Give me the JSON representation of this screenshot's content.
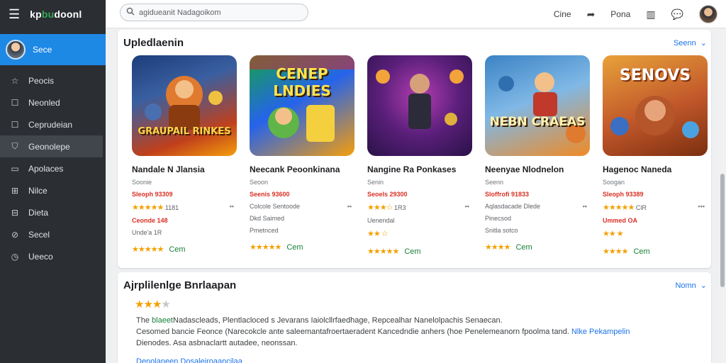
{
  "app": {
    "brand_main": "kp",
    "brand_accent": "bu",
    "brand_rest": "doonl"
  },
  "sidebar": {
    "profile_label": "Sece",
    "items": [
      {
        "label": "Peocis",
        "icon": "star-icon"
      },
      {
        "label": "Neonled",
        "icon": "square-icon"
      },
      {
        "label": "Ceprudeian",
        "icon": "square-icon"
      },
      {
        "label": "Geonolepe",
        "icon": "shield-icon",
        "active": true
      },
      {
        "label": "Apolaces",
        "icon": "rect-icon"
      },
      {
        "label": "Nilce",
        "icon": "grid-icon"
      },
      {
        "label": "Dieta",
        "icon": "grid-icon"
      },
      {
        "label": "Secel",
        "icon": "pin-icon"
      },
      {
        "label": "Ueeco",
        "icon": "clock-icon"
      }
    ]
  },
  "topbar": {
    "search_value": "agidueanit Nadagoikom",
    "action_1": "Cine",
    "action_2": "Pona"
  },
  "featured": {
    "title": "Upledlaenin",
    "more_label": "Seenn",
    "games": [
      {
        "art_text": "GRAUPAIL RINKES",
        "title": "Nandale N Jlansia",
        "sub": "Soonie",
        "price": "Sleoph 93309",
        "rating_count": "1181",
        "line2_left": "Ceonde 148",
        "line2_right": "",
        "line3": "Unde'a 1R",
        "get": "Cem",
        "c1": "#1d3d7a",
        "c2": "#c0401c"
      },
      {
        "art_text": "CENEP LNDIES",
        "title": "Neecank Peoonkinana",
        "sub": "Seoon",
        "price": "Seenis 93600",
        "rating_count": "",
        "line2_left": "Colcole Sentoode",
        "line2_right": "",
        "line3": "Dkd Saimed",
        "line4": "Pmetnced",
        "get": "Cem",
        "c1": "#16a34a",
        "c2": "#f59e0b"
      },
      {
        "art_text": "",
        "title": "Nangine Ra Ponkases",
        "sub": "Senin",
        "price": "Seoels 29300",
        "rating_count": "1R3",
        "line2_left": "Uenendal",
        "line2_right": "",
        "line3": "",
        "get": "Cem",
        "c1": "#2a1248",
        "c2": "#b23db0"
      },
      {
        "art_text": "NEBN CRAEAS",
        "title": "Neenyae Nlodnelon",
        "sub": "Seenn",
        "price": "Sloffrofi 91833",
        "rating_count": "",
        "line2_left": "Aqlasdacade Dlede",
        "line2_right": "",
        "line3": "Pinecsod",
        "line4": "Snitla sotco",
        "get": "Cem",
        "c1": "#3b82c4",
        "c2": "#f08a24"
      },
      {
        "art_text": "SENOVS",
        "title": "Hagenoc Naneda",
        "sub": "Soogan",
        "price": "Sleoph 93389",
        "rating_count": "ClR",
        "line2_left": "Ummed OA",
        "line2_right": "",
        "line3": "",
        "get": "Cem",
        "c1": "#e8a23a",
        "c2": "#7c2f10"
      }
    ]
  },
  "review": {
    "title": "Ajrplilenlge Bnrlaapan",
    "more_label": "Nomn",
    "rating": 3,
    "line1_pre": "The ",
    "line1_hl": "blaeet",
    "line1_post": "Nadascleads, Plentlacloced s Jevarans Iaiolcllrfaedhage, Repcealhar Nanelolpachis Senaecan.",
    "line2": "Cesomed bancie Feonce (Narecokcle ante saleemantafroertaeradent Kancedndie anhers (hoe Penelemeanorn fpoolma tand.",
    "line2_link": "Nlke Pekampelin",
    "line3": "Dienodes. Asa asbnaclartt autadee, neonssan.",
    "footer_link": "Denolaneen Dosaleiroaancilaa"
  }
}
